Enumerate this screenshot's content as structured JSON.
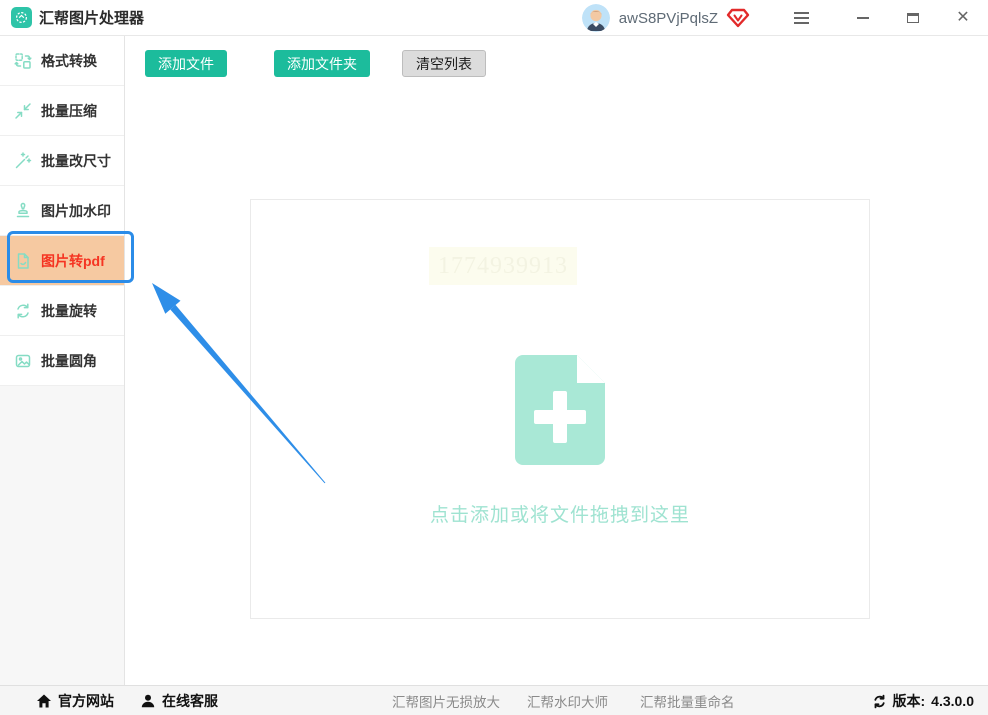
{
  "titlebar": {
    "app_title": "汇帮图片处理器",
    "username": "awS8PVjPqlsZ"
  },
  "icons": {
    "close": "✕"
  },
  "sidebar": {
    "items": [
      {
        "label": "格式转换",
        "selected": false
      },
      {
        "label": "批量压缩",
        "selected": false
      },
      {
        "label": "批量改尺寸",
        "selected": false
      },
      {
        "label": "图片加水印",
        "selected": false
      },
      {
        "label": "图片转pdf",
        "selected": true
      },
      {
        "label": "批量旋转",
        "selected": false
      },
      {
        "label": "批量圆角",
        "selected": false
      }
    ]
  },
  "toolbar": {
    "add_files": "添加文件",
    "add_folder": "添加文件夹",
    "clear_list": "清空列表"
  },
  "dropzone": {
    "watermark": "1774939913",
    "hint": "点击添加或将文件拖拽到这里"
  },
  "statusbar": {
    "official_site": "官方网站",
    "online_service": "在线客服",
    "links": [
      "汇帮图片无损放大",
      "汇帮水印大师",
      "汇帮批量重命名"
    ],
    "version_label": "版本:",
    "version": "4.3.0.0"
  },
  "colors": {
    "accent_teal": "#1cbc9c",
    "icon_teal": "#85dcc4",
    "selected_bg": "#f6c9a1",
    "selected_text": "#f53422",
    "annotation_blue": "#2b8ce8",
    "vip_red": "#e22a2a"
  }
}
